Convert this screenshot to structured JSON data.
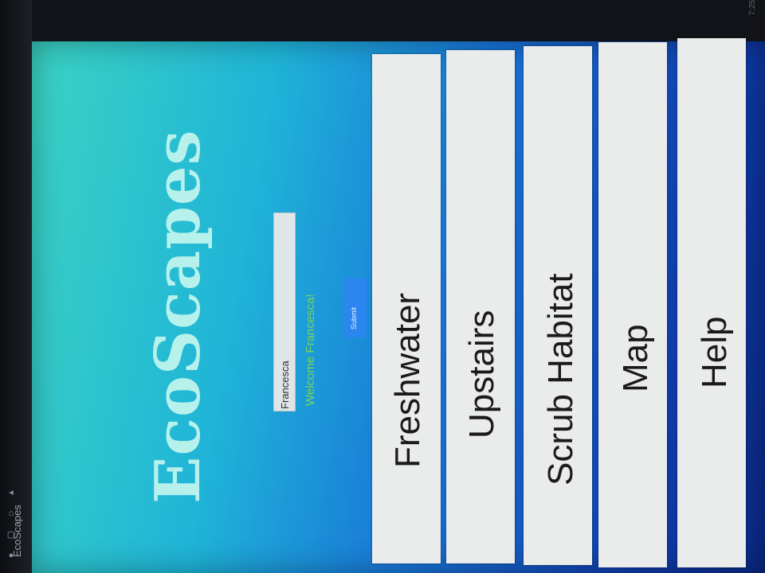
{
  "statusbar": {
    "app_title": "EcoScapes",
    "icons": [
      "back-icon",
      "home-icon",
      "recent-apps-icon",
      "notification-icon"
    ],
    "time_text": "7:25"
  },
  "app": {
    "logo": "EcoScapes",
    "name_input_value": "Francesca",
    "welcome_text": "Welcome Francesca!",
    "submit_label": "Submit"
  },
  "nav": {
    "freshwater": "Freshwater",
    "upstairs": "Upstairs",
    "scrub_habitat": "Scrub Habitat",
    "map": "Map",
    "help": "Help"
  },
  "colors": {
    "gradient_start": "#3bd3c3",
    "gradient_end": "#0a2a86",
    "logo": "#b7f1ec",
    "welcome": "#76d65a",
    "submit_bg": "#2c86f0",
    "nav_button_bg": "#e9ecea"
  }
}
